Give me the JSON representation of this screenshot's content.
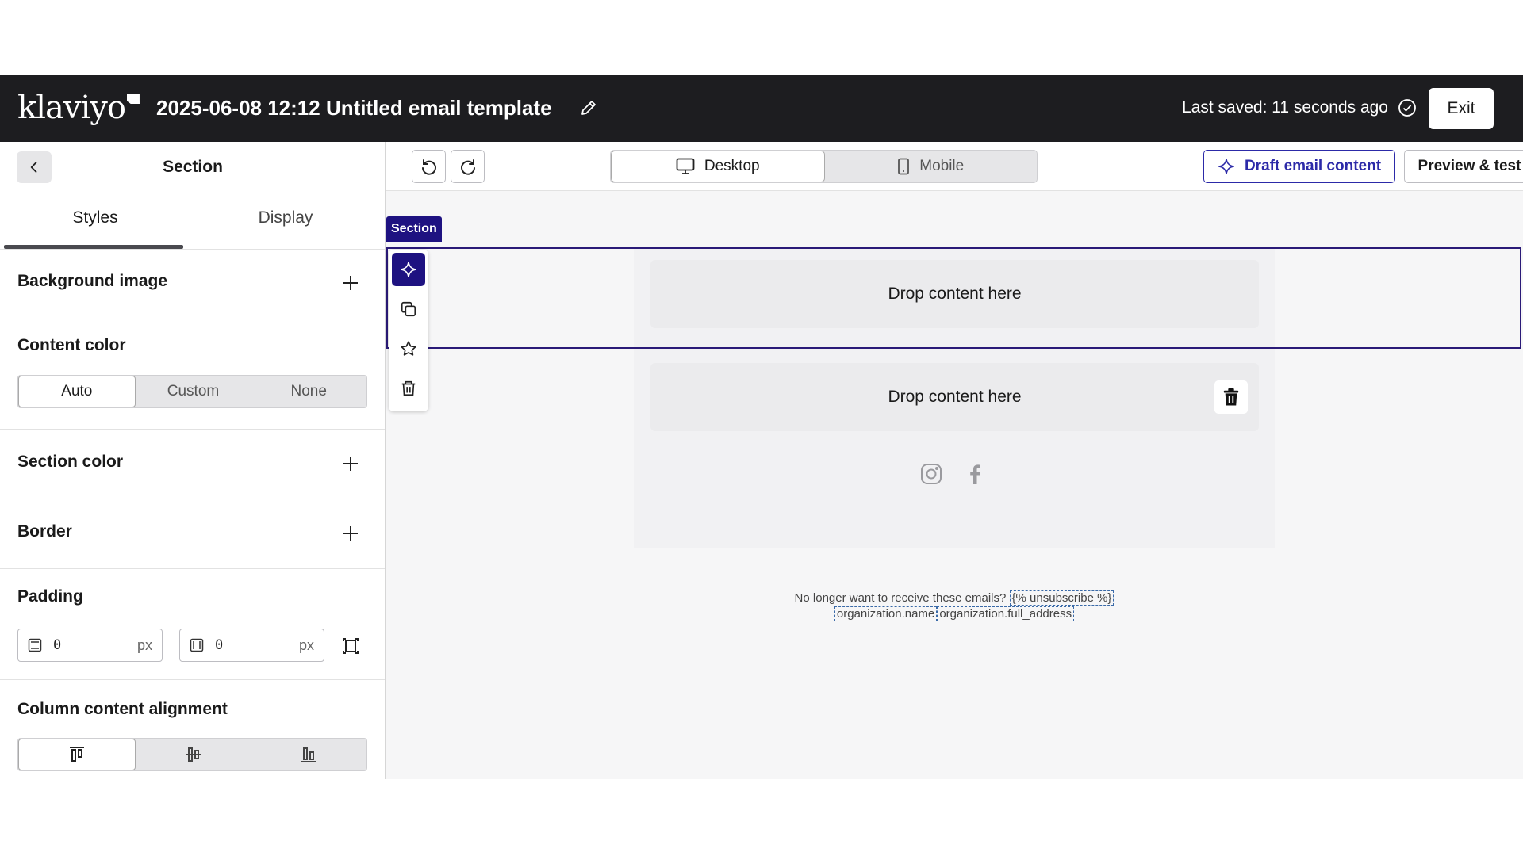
{
  "header": {
    "logo_text": "klaviyo",
    "title": "2025-06-08 12:12 Untitled email template",
    "saved_status": "Last saved: 11 seconds ago",
    "exit_label": "Exit"
  },
  "left_panel": {
    "title": "Section",
    "tabs": {
      "styles": "Styles",
      "display": "Display"
    },
    "background_image": "Background image",
    "content_color": {
      "label": "Content color",
      "options": [
        "Auto",
        "Custom",
        "None"
      ],
      "selected": "Auto"
    },
    "section_color": "Section color",
    "border": "Border",
    "padding": {
      "label": "Padding",
      "vertical_value": "0",
      "horizontal_value": "0",
      "unit": "px"
    },
    "column_alignment": {
      "label": "Column content alignment",
      "selected": "top"
    }
  },
  "toolbar": {
    "views": [
      "Desktop",
      "Mobile"
    ],
    "selected_view": "Desktop",
    "draft_label": "Draft email content",
    "preview_label": "Preview & test"
  },
  "canvas": {
    "section_tag": "Section",
    "drop_zone_1": "Drop content here",
    "drop_zone_2": "Drop content here",
    "footer": {
      "prefix": "No longer want to receive these emails?",
      "unsubscribe_tag": "{% unsubscribe %}",
      "org_name_tag": "organization.name",
      "org_address_tag": "organization.full_address"
    }
  },
  "colors": {
    "header_bg": "#1d1d20",
    "accent": "#1e1281",
    "draft_accent": "#2c2aa8"
  }
}
